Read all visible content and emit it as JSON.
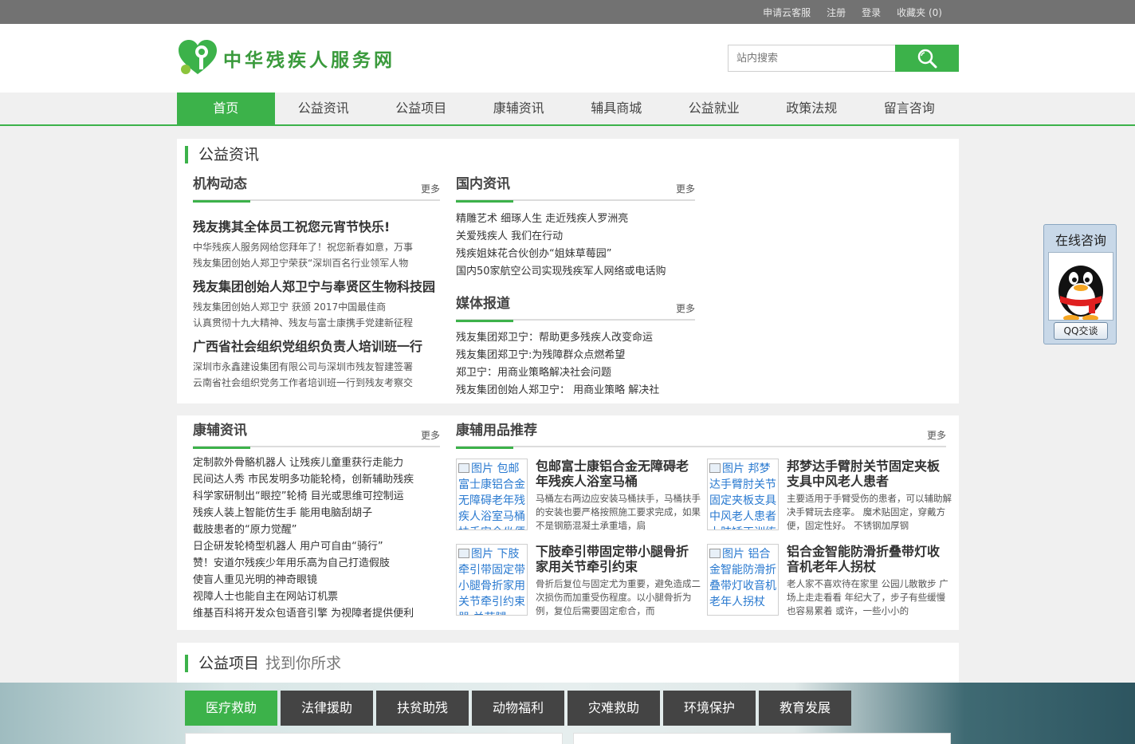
{
  "topbar": {
    "links": [
      "申请云客服",
      "注册",
      "登录",
      "收藏夹 (0)"
    ]
  },
  "header": {
    "logo_text": "中华残疾人服务网",
    "search_placeholder": "站内搜索"
  },
  "nav": {
    "items": [
      "首页",
      "公益资讯",
      "公益项目",
      "康辅资讯",
      "辅具商城",
      "公益就业",
      "政策法规",
      "留言咨询"
    ],
    "active": "首页"
  },
  "section1": {
    "title": "公益资讯",
    "org": {
      "heading": "机构动态",
      "more": "更多",
      "items": [
        {
          "title": "残友携其全体员工祝您元宵节快乐!",
          "lines": [
            "中华残疾人服务网给您拜年了！祝您新春如意，万事",
            "残友集团创始人郑卫宁荣获“深圳百名行业领军人物"
          ]
        },
        {
          "title": "残友集团创始人郑卫宁与奉贤区生物科技园",
          "lines": [
            "残友集团创始人郑卫宁 获颁 2017中国最佳商",
            "认真贯彻十九大精神、残友与富士康携手党建新征程"
          ]
        },
        {
          "title": "广西省社会组织党组织负责人培训班一行",
          "lines": [
            "深圳市永鑫建设集团有限公司与深圳市残友智建签署",
            "云南省社会组织党务工作者培训班一行到残友考察交"
          ]
        }
      ]
    },
    "domestic": {
      "heading": "国内资讯",
      "more": "更多",
      "items": [
        "精雕艺术 细琢人生 走近残疾人罗洲亮",
        "关爱残疾人 我们在行动",
        "残疾姐妹花合伙创办“姐妹草莓园”",
        "国内50家航空公司实现残疾军人网络或电话购"
      ]
    },
    "media": {
      "heading": "媒体报道",
      "more": "更多",
      "items": [
        "残友集团郑卫宁：帮助更多残疾人改变命运",
        "残友集团郑卫宁:为残障群众点燃希望",
        "郑卫宁：用商业策略解决社会问题",
        "残友集团创始人郑卫宁： 用商业策略 解决社"
      ]
    }
  },
  "section2": {
    "rehab": {
      "heading": "康辅资讯",
      "more": "更多",
      "items": [
        "定制款外骨骼机器人 让残疾儿童重获行走能力",
        "民间达人秀 市民发明多功能轮椅，创新辅助残疾",
        "科学家研制出“眼控”轮椅 目光或思维可控制运",
        "残疾人装上智能仿生手 能用电脑刮胡子",
        "截肢患者的“原力觉醒”",
        "日企研发轮椅型机器人 用户可自由“骑行”",
        "赞！安道尔残疾少年用乐高为自己打造假肢",
        "使盲人重见光明的神奇眼镜",
        "视障人士也能自主在网站订机票",
        "维基百科将开发众包语音引擎 为视障者提供便利"
      ]
    },
    "products": {
      "heading": "康辅用品推荐",
      "more": "更多",
      "items": [
        {
          "alt": "图片 包邮富士康铝合金无障碍老年残疾人浴室马桶扶手安全坐便",
          "title": "包邮富士康铝合金无障碍老年残疾人浴室马桶",
          "desc": "马桶左右两边应安装马桶扶手，马桶扶手的安装也要严格按照施工要求完成，如果不是钢筋混凝土承重墙，扃"
        },
        {
          "alt": "图片 邦梦达手臂肘关节固定夹板支具中风老人患者上肢矫正训练",
          "title": "邦梦达手臂肘关节固定夹板支具中风老人患者",
          "desc": "主要适用于手臂受伤的患者，可以辅助解决手臂玩去痉挛。 魔术贴固定，穿戴方便，固定性好。 不锈钢加厚钢"
        },
        {
          "alt": "图片 下肢牵引带固定带小腿骨折家用关节牵引约束器 关节腿",
          "title": "下肢牵引带固定带小腿骨折家用关节牵引约束",
          "desc": "骨折后复位与固定尤为重要，避免造成二次损伤而加重受伤程度。以小腿骨折为例，复位后需要固定愈合，而"
        },
        {
          "alt": "图片 铝合金智能防滑折叠带灯收音机老年人拐杖",
          "title": "铝合金智能防滑折叠带灯收音机老年人拐杖",
          "desc": "老人家不喜欢待在家里 公园儿散散步 广场上走走看看 年纪大了，步子有些缓慢 也容易累着 或许，一些小小的"
        }
      ]
    }
  },
  "section3": {
    "title": "公益项目",
    "subtitle": "找到你所求",
    "tabs": [
      "医疗救助",
      "法律援助",
      "扶贫助残",
      "动物福利",
      "灾难救助",
      "环境保护",
      "教育发展"
    ],
    "active_tab": "医疗救助"
  },
  "float_qq": {
    "title": "在线咨询",
    "button": "QQ交谈"
  },
  "colors": {
    "brand_green": "#3cb24a",
    "topbar": "#727272",
    "tab_dark": "#444444"
  }
}
